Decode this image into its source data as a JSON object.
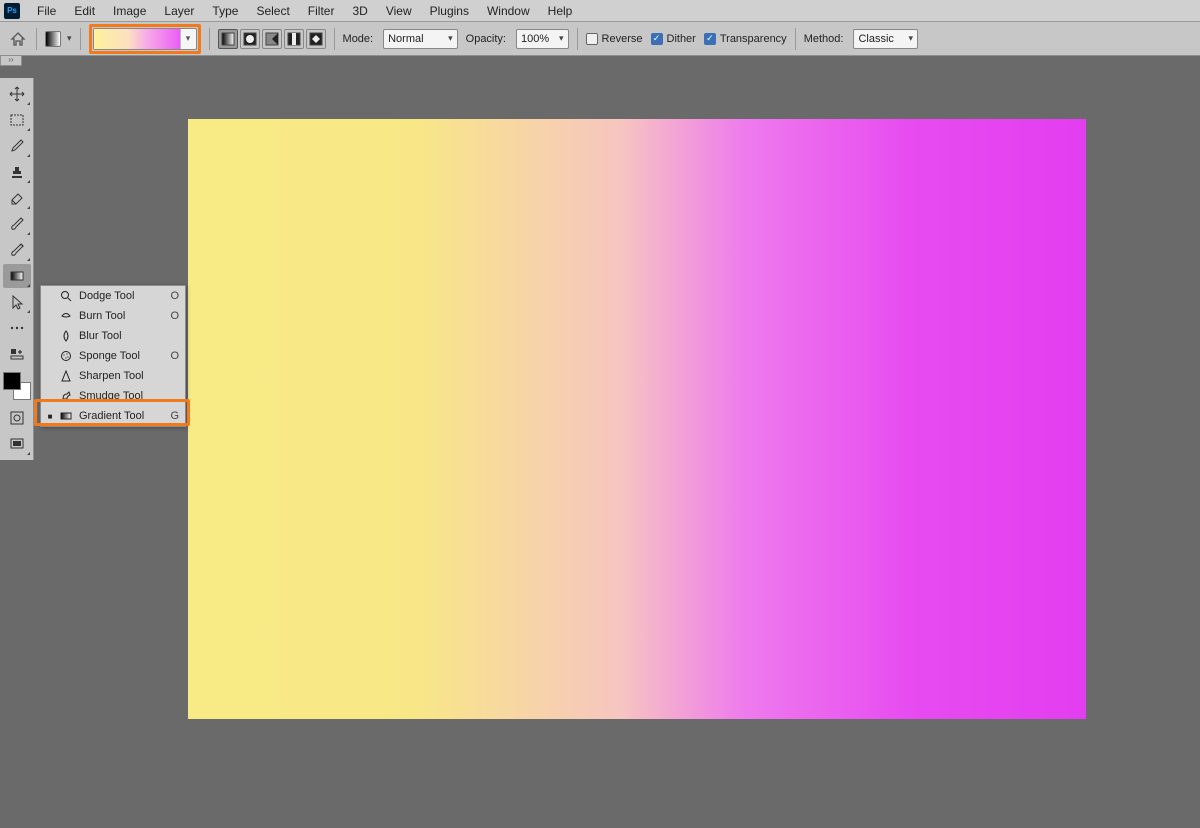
{
  "app_logo": "Ps",
  "menu": [
    "File",
    "Edit",
    "Image",
    "Layer",
    "Type",
    "Select",
    "Filter",
    "3D",
    "View",
    "Plugins",
    "Window",
    "Help"
  ],
  "options": {
    "mode_label": "Mode:",
    "mode_value": "Normal",
    "opacity_label": "Opacity:",
    "opacity_value": "100%",
    "reverse_label": "Reverse",
    "reverse_checked": false,
    "dither_label": "Dither",
    "dither_checked": true,
    "transparency_label": "Transparency",
    "transparency_checked": true,
    "method_label": "Method:",
    "method_value": "Classic"
  },
  "gradient_types": [
    "linear",
    "radial",
    "angle",
    "reflected",
    "diamond"
  ],
  "tools": [
    {
      "name": "move-tool",
      "tri": true
    },
    {
      "name": "marquee-tool",
      "tri": true
    },
    {
      "name": "eyedropper-tool",
      "tri": true
    },
    {
      "name": "stamp-tool",
      "tri": true
    },
    {
      "name": "eraser-tool",
      "tri": true
    },
    {
      "name": "brush-tool",
      "tri": true
    },
    {
      "name": "history-brush-tool",
      "tri": true
    },
    {
      "name": "gradient-tool",
      "tri": true,
      "active": true
    },
    {
      "name": "path-select-tool",
      "tri": true
    },
    {
      "name": "more-tool",
      "tri": false
    },
    {
      "name": "edit-toolbar",
      "tri": false
    }
  ],
  "flyout": {
    "items": [
      {
        "label": "Dodge Tool",
        "key": "O",
        "dot": false
      },
      {
        "label": "Burn Tool",
        "key": "O",
        "dot": false
      },
      {
        "label": "Blur Tool",
        "key": "",
        "dot": false
      },
      {
        "label": "Sponge Tool",
        "key": "O",
        "dot": false
      },
      {
        "label": "Sharpen Tool",
        "key": "",
        "dot": false
      },
      {
        "label": "Smudge Tool",
        "key": "",
        "dot": false
      },
      {
        "label": "Gradient Tool",
        "key": "G",
        "dot": true
      }
    ]
  }
}
